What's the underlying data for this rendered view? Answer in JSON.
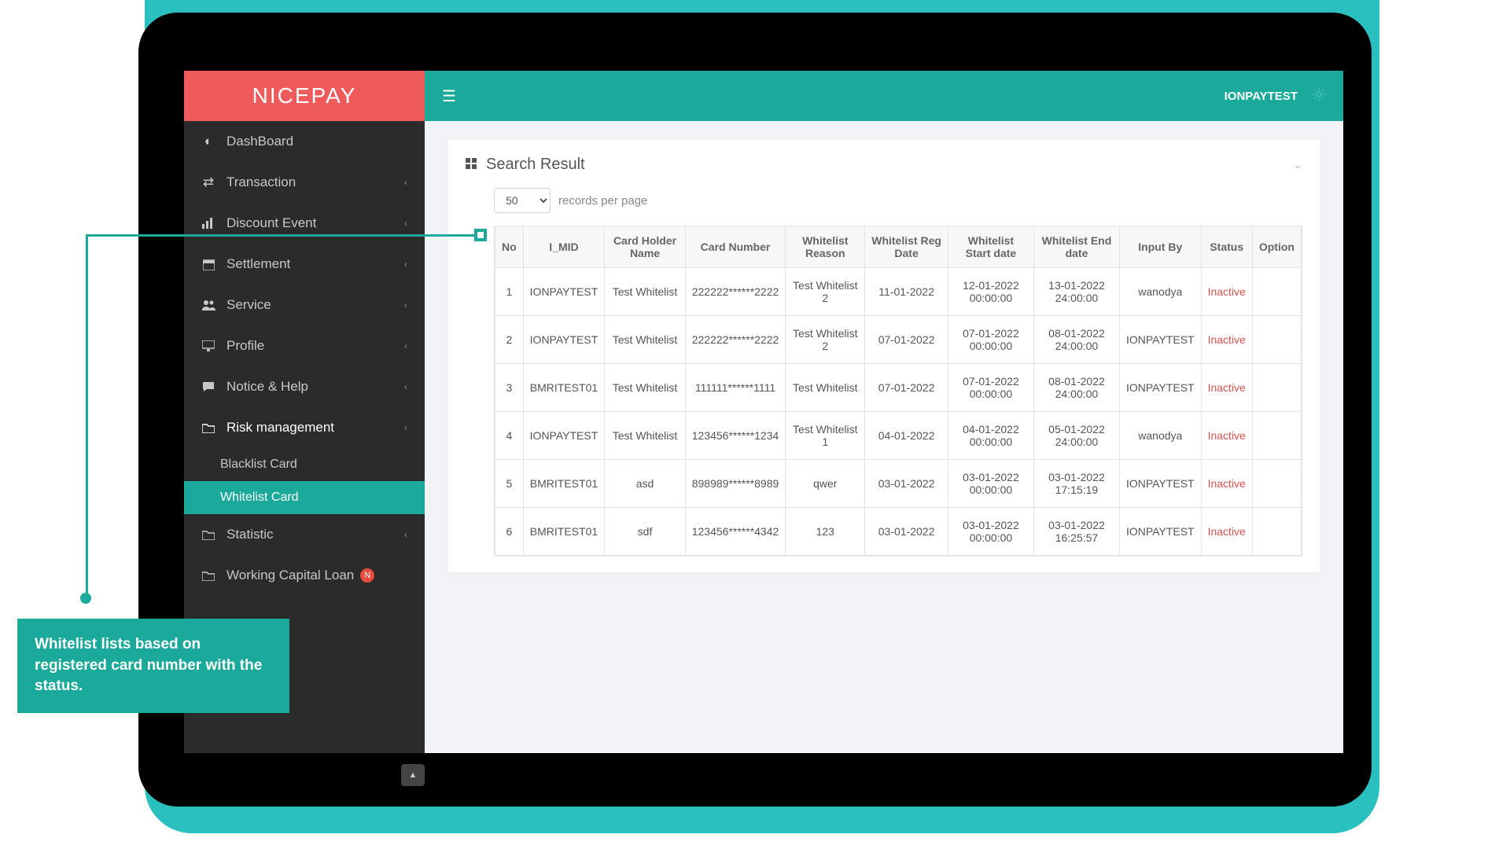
{
  "brand": "NICEPAY",
  "topbar": {
    "user": "IONPAYTEST"
  },
  "sidebar": {
    "items": [
      {
        "label": "DashBoard"
      },
      {
        "label": "Transaction"
      },
      {
        "label": "Discount Event"
      },
      {
        "label": "Settlement"
      },
      {
        "label": "Service"
      },
      {
        "label": "Profile"
      },
      {
        "label": "Notice & Help"
      },
      {
        "label": "Risk management"
      },
      {
        "label": "Statistic"
      },
      {
        "label": "Working Capital Loan"
      }
    ],
    "sub": {
      "blacklist": "Blacklist Card",
      "whitelist": "Whitelist Card"
    },
    "new_badge": "N"
  },
  "panel": {
    "title": "Search Result",
    "records_value": "50",
    "records_label": "records per page"
  },
  "columns": {
    "no": "No",
    "i_mid": "I_MID",
    "holder": "Card Holder Name",
    "card": "Card Number",
    "reason": "Whitelist Reason",
    "reg": "Whitelist Reg Date",
    "start": "Whitelist Start date",
    "end": "Whitelist End date",
    "input": "Input By",
    "status": "Status",
    "option": "Option"
  },
  "rows": [
    {
      "no": "1",
      "i_mid": "IONPAYTEST",
      "holder": "Test Whitelist",
      "card": "222222******2222",
      "reason": "Test Whitelist 2",
      "reg": "11-01-2022",
      "start": "12-01-2022 00:00:00",
      "end": "13-01-2022 24:00:00",
      "input": "wanodya",
      "status": "Inactive"
    },
    {
      "no": "2",
      "i_mid": "IONPAYTEST",
      "holder": "Test Whitelist",
      "card": "222222******2222",
      "reason": "Test Whitelist 2",
      "reg": "07-01-2022",
      "start": "07-01-2022 00:00:00",
      "end": "08-01-2022 24:00:00",
      "input": "IONPAYTEST",
      "status": "Inactive"
    },
    {
      "no": "3",
      "i_mid": "BMRITEST01",
      "holder": "Test Whitelist",
      "card": "111111******1111",
      "reason": "Test Whitelist",
      "reg": "07-01-2022",
      "start": "07-01-2022 00:00:00",
      "end": "08-01-2022 24:00:00",
      "input": "IONPAYTEST",
      "status": "Inactive"
    },
    {
      "no": "4",
      "i_mid": "IONPAYTEST",
      "holder": "Test Whitelist",
      "card": "123456******1234",
      "reason": "Test Whitelist 1",
      "reg": "04-01-2022",
      "start": "04-01-2022 00:00:00",
      "end": "05-01-2022 24:00:00",
      "input": "wanodya",
      "status": "Inactive"
    },
    {
      "no": "5",
      "i_mid": "BMRITEST01",
      "holder": "asd",
      "card": "898989******8989",
      "reason": "qwer",
      "reg": "03-01-2022",
      "start": "03-01-2022 00:00:00",
      "end": "03-01-2022 17:15:19",
      "input": "IONPAYTEST",
      "status": "Inactive"
    },
    {
      "no": "6",
      "i_mid": "BMRITEST01",
      "holder": "sdf",
      "card": "123456******4342",
      "reason": "123",
      "reg": "03-01-2022",
      "start": "03-01-2022 00:00:00",
      "end": "03-01-2022 16:25:57",
      "input": "IONPAYTEST",
      "status": "Inactive"
    }
  ],
  "callout": "Whitelist lists based on registered card number with the status."
}
